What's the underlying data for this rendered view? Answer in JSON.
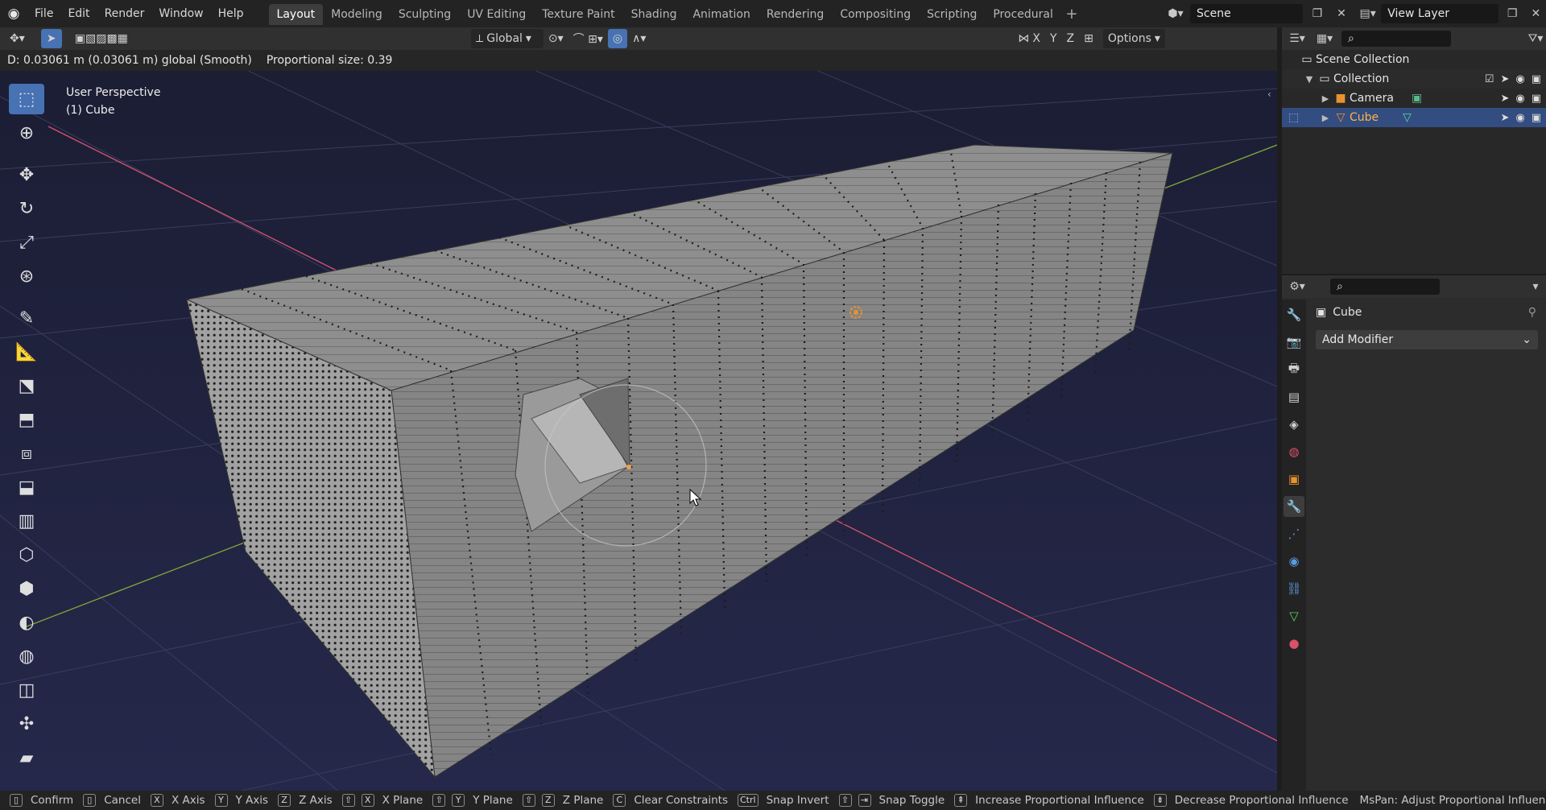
{
  "menu": [
    "File",
    "Edit",
    "Render",
    "Window",
    "Help"
  ],
  "workspaces": {
    "active": "Layout",
    "tabs": [
      "Layout",
      "Modeling",
      "Sculpting",
      "UV Editing",
      "Texture Paint",
      "Shading",
      "Animation",
      "Rendering",
      "Compositing",
      "Scripting",
      "Procedural"
    ]
  },
  "scene": {
    "name": "Scene"
  },
  "view_layer": {
    "name": "View Layer"
  },
  "viewport_header": {
    "orientation": "Global",
    "options": "Options",
    "axes": [
      "X",
      "Y",
      "Z"
    ]
  },
  "operator_status": {
    "delta": "D: 0.03061 m (0.03061 m) global (Smooth)",
    "proportional": "Proportional size: 0.39"
  },
  "viewport": {
    "view_name": "User Perspective",
    "object_name": "(1) Cube"
  },
  "outliner": {
    "root": "Scene Collection",
    "collection": "Collection",
    "items": [
      {
        "name": "Camera",
        "selected": false
      },
      {
        "name": "Cube",
        "selected": true
      }
    ]
  },
  "properties": {
    "object": "Cube",
    "add_modifier": "Add Modifier"
  },
  "statusbar": [
    {
      "keys": [],
      "label": "Confirm"
    },
    {
      "keys": [],
      "label": "Cancel"
    },
    {
      "keys": [
        "X"
      ],
      "label": "X Axis"
    },
    {
      "keys": [
        "Y"
      ],
      "label": "Y Axis"
    },
    {
      "keys": [
        "Z"
      ],
      "label": "Z Axis"
    },
    {
      "keys": [
        "⇧",
        "X"
      ],
      "label": "X Plane"
    },
    {
      "keys": [
        "⇧",
        "Y"
      ],
      "label": "Y Plane"
    },
    {
      "keys": [
        "⇧",
        "Z"
      ],
      "label": "Z Plane"
    },
    {
      "keys": [
        "C"
      ],
      "label": "Clear Constraints"
    },
    {
      "keys": [
        "Ctrl"
      ],
      "label": "Snap Invert"
    },
    {
      "keys": [
        "⇧",
        "⇥"
      ],
      "label": "Snap Toggle"
    },
    {
      "keys": [
        "⇞"
      ],
      "label": "Increase Proportional Influence"
    },
    {
      "keys": [
        "⇟"
      ],
      "label": "Decrease Proportional Influence"
    },
    {
      "keys": [],
      "label": "MsPan: Adjust Proportional Influence"
    }
  ],
  "colors": {
    "accent": "#4772b3",
    "selected_row": "#334d80",
    "object_orange": "#e8922e",
    "x_axis": "#d9516b",
    "y_axis": "#7fa83a"
  }
}
